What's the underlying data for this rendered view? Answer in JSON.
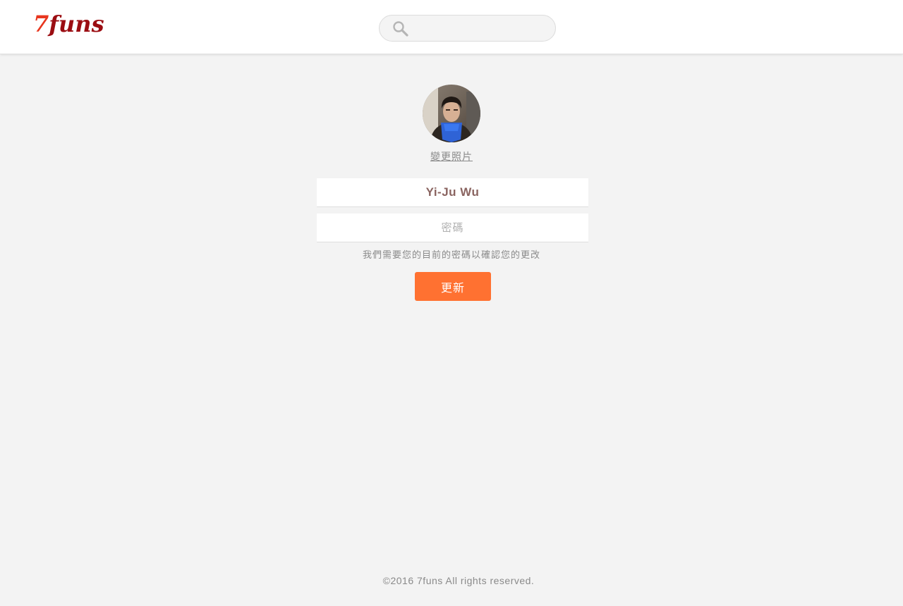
{
  "header": {
    "logo_digit": "7",
    "logo_word": "funs",
    "search": {
      "placeholder": "",
      "value": ""
    }
  },
  "profile": {
    "change_photo_label": "變更照片",
    "name": "Yi-Ju Wu",
    "password_placeholder": "密碼",
    "hint": "我們需要您的目前的密碼以確認您的更改",
    "update_label": "更新"
  },
  "footer": {
    "copyright": "©2016 7funs All rights reserved."
  },
  "colors": {
    "accent": "#ff7131",
    "brand_dark": "#9b0d12",
    "brand_light": "#e8361e",
    "name_text": "#8a6460"
  },
  "icons": {
    "search": "search-icon",
    "avatar": "avatar"
  }
}
